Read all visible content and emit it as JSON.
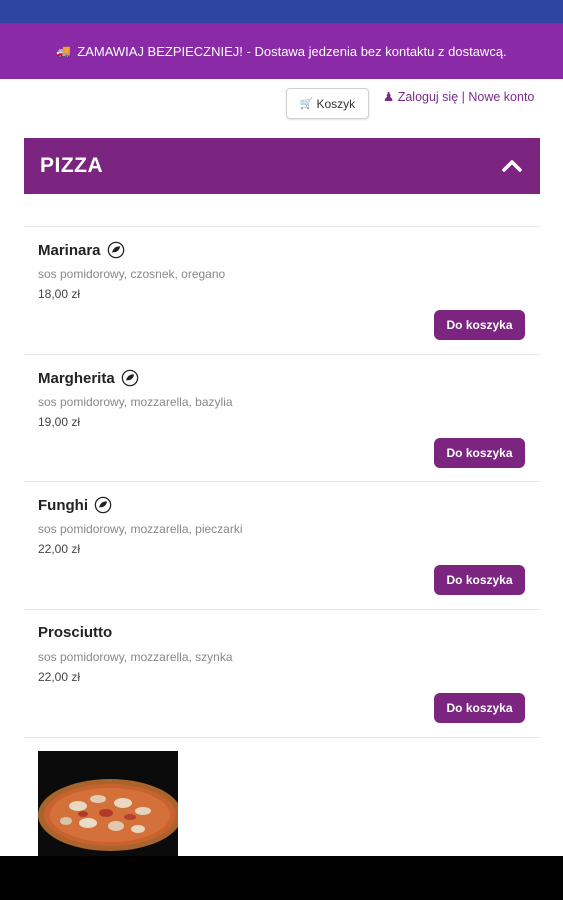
{
  "banner": {
    "text": "ZAMAWIAJ BEZPIECZNIEJ! - Dostawa jedzenia bez kontaktu z dostawcą."
  },
  "header": {
    "cart_label": "Koszyk",
    "login_label": "Zaloguj się",
    "separator": "|",
    "register_label": "Nowe konto"
  },
  "section": {
    "title": "PIZZA"
  },
  "items": [
    {
      "name": "Marinara",
      "vegetarian": true,
      "description": "sos pomidorowy, czosnek, oregano",
      "price": "18,00 zł",
      "button": "Do koszyka"
    },
    {
      "name": "Margherita",
      "vegetarian": true,
      "description": "sos pomidorowy, mozzarella, bazylia",
      "price": "19,00 zł",
      "button": "Do koszyka"
    },
    {
      "name": "Funghi",
      "vegetarian": true,
      "description": "sos pomidorowy, mozzarella, pieczarki",
      "price": "22,00 zł",
      "button": "Do koszyka"
    },
    {
      "name": "Prosciutto",
      "vegetarian": false,
      "description": "sos pomidorowy, mozzarella, szynka",
      "price": "22,00 zł",
      "button": "Do koszyka"
    }
  ],
  "colors": {
    "primary": "#7b2480",
    "banner": "#8a2aa6",
    "statusbar": "#2e45a0"
  }
}
